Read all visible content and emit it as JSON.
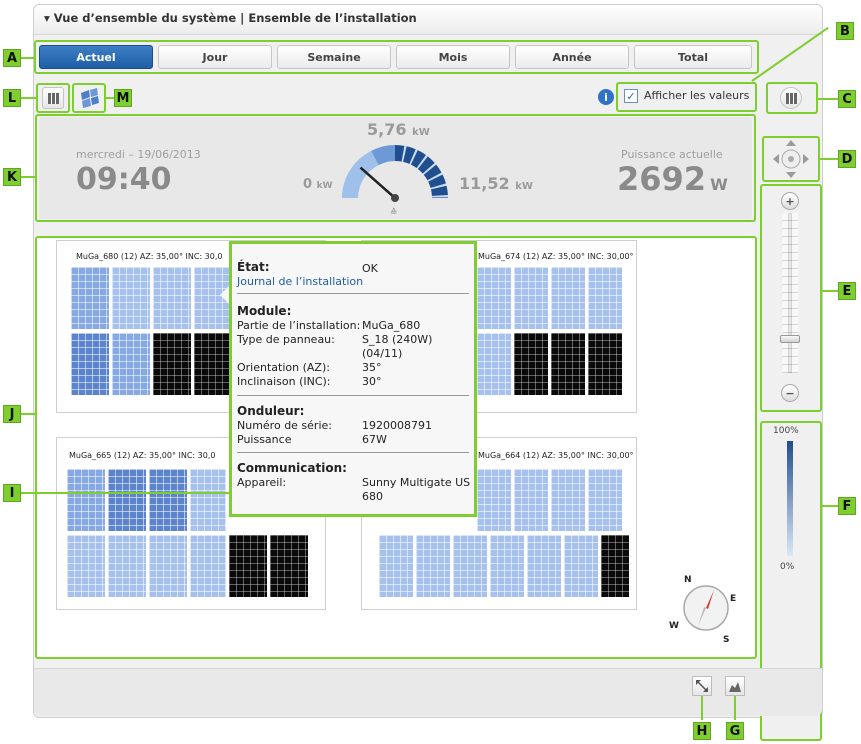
{
  "window": {
    "title": "▾ Vue d’ensemble du système | Ensemble de l’installation"
  },
  "tabs": [
    {
      "label": "Actuel",
      "active": true
    },
    {
      "label": "Jour"
    },
    {
      "label": "Semaine"
    },
    {
      "label": "Mois"
    },
    {
      "label": "Année"
    },
    {
      "label": "Total"
    }
  ],
  "toolbar": {
    "show_values_label": "Afficher les valeurs",
    "show_values_checked": true,
    "info_icon": "info-icon"
  },
  "gauge": {
    "date": "mercredi – 19/06/2013",
    "time": "09:40",
    "max_label": "5,76",
    "max_unit": "kW",
    "min_label": "0",
    "min_unit": "kW",
    "right_label": "11,52",
    "right_unit": "kW",
    "power_caption": "Puissance actuelle",
    "power_value": "2692",
    "power_unit": "W",
    "needle_fraction": 0.23
  },
  "cards": [
    {
      "label": "MuGa_680 (12) AZ: 35,00° INC: 30,0"
    },
    {
      "label": "MuGa_674 (12) AZ: 35,00° INC: 30,00°"
    },
    {
      "label": "MuGa_665 (12) AZ: 35,00° INC: 30,0"
    },
    {
      "label": "MuGa_664 (12) AZ: 35,00° INC: 30,00°"
    }
  ],
  "tooltip": {
    "state_label": "État:",
    "state_value": "OK",
    "journal_link": "Journal de l’installation",
    "module_header": "Module:",
    "module_rows": [
      {
        "k": "Partie de l’installation:",
        "v": "MuGa_680"
      },
      {
        "k": "Type de panneau:",
        "v": "S_18 (240W)"
      },
      {
        "k": "",
        "v": "(04/11)"
      },
      {
        "k": "Orientation (AZ):",
        "v": "35°"
      },
      {
        "k": "Inclinaison (INC):",
        "v": "30°"
      }
    ],
    "inverter_header": "Onduleur:",
    "inverter_rows": [
      {
        "k": "Numéro de série:",
        "v": "1920008791"
      },
      {
        "k": "Puissance",
        "v": "67W"
      }
    ],
    "comm_header": "Communication:",
    "comm_rows": [
      {
        "k": "Appareil:",
        "v": "Sunny Multigate US"
      },
      {
        "k": "",
        "v": "680"
      }
    ]
  },
  "compass": {
    "n": "N",
    "e": "E",
    "s": "S",
    "w": "W"
  },
  "scale": {
    "top": "100%",
    "bottom": "0%"
  },
  "zoom": {
    "plus": "+",
    "minus": "−",
    "level": 0.2
  },
  "callouts": {
    "A": "A",
    "B": "B",
    "C": "C",
    "D": "D",
    "E": "E",
    "F": "F",
    "G": "G",
    "H": "H",
    "I": "I",
    "J": "J",
    "K": "K",
    "L": "L",
    "M": "M"
  },
  "colors": {
    "accent_green": "#7fce2f",
    "active_tab": "#2a6db5",
    "gauge_blue": "#1f4f8f"
  }
}
